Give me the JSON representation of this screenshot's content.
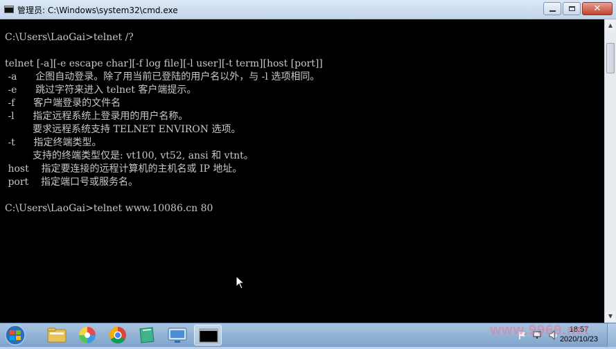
{
  "window": {
    "title": "管理员: C:\\Windows\\system32\\cmd.exe",
    "close_glyph": "✕"
  },
  "console": {
    "lines": [
      "C:\\Users\\LaoGai>telnet /?",
      "",
      "telnet [-a][-e escape char][-f log file][-l user][-t term][host [port]]",
      " -a      企图自动登录。除了用当前已登陆的用户名以外，与 -l 选项相同。",
      " -e      跳过字符来进入 telnet 客户端提示。",
      " -f      客户端登录的文件名",
      " -l      指定远程系统上登录用的用户名称。",
      "         要求远程系统支持 TELNET ENVIRON 选项。",
      " -t      指定终端类型。",
      "         支持的终端类型仅是: vt100, vt52, ansi 和 vtnt。",
      " host    指定要连接的远程计算机的主机名或 IP 地址。",
      " port    指定端口号或服务名。",
      "",
      "C:\\Users\\LaoGai>telnet www.10086.cn 80"
    ]
  },
  "scrollbar": {
    "up_glyph": "▲",
    "down_glyph": "▼"
  },
  "taskbar": {
    "items": [
      "start-orb",
      "file-explorer",
      "pinwheel-app",
      "chrome",
      "green-app",
      "remote-desktop",
      "cmd"
    ],
    "clock_time": "18:57",
    "clock_date": "2020/10/23",
    "watermark": "www.9969.net"
  },
  "colors": {
    "console_bg": "#000000",
    "console_fg": "#c8c8c8",
    "titlebar": "#c2d5ea",
    "taskbar": "#7ea3cb",
    "close_button": "#c2432e"
  }
}
